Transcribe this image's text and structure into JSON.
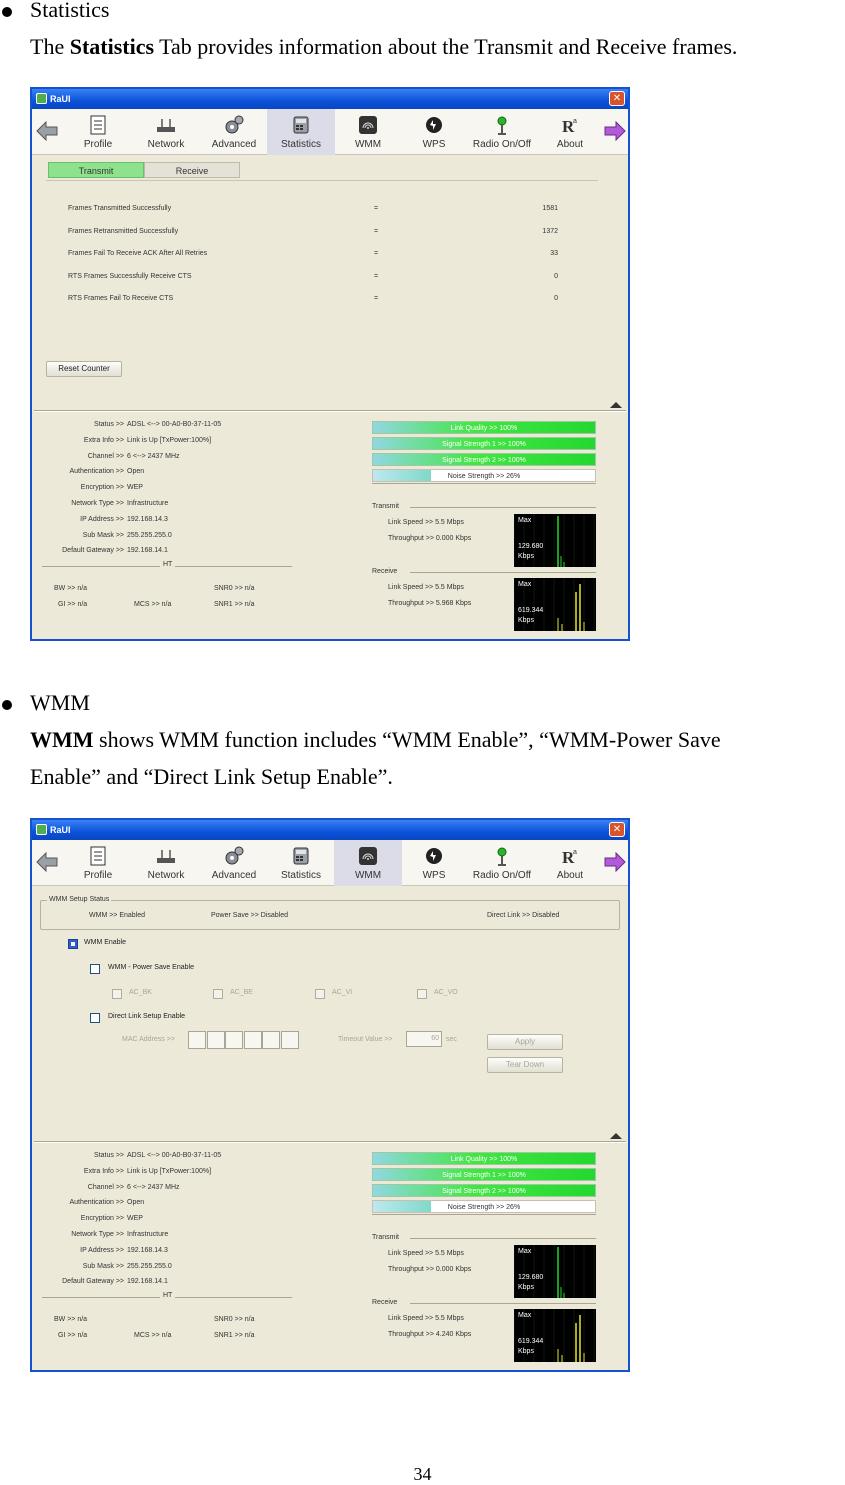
{
  "section1": {
    "heading": "Statistics",
    "intro_prefix": "The ",
    "intro_bold": "Statistics",
    "intro_suffix": " Tab provides information about the Transmit and Receive frames."
  },
  "section2": {
    "heading": "WMM",
    "intro_bold": "WMM",
    "intro_line1": " shows WMM function includes “WMM Enable”, “WMM-Power Save",
    "intro_line2": "Enable” and “Direct Link Setup Enable”."
  },
  "page_number": "34",
  "app": {
    "title": "RaUI",
    "close_glyph": "✕",
    "toolbar": [
      "Profile",
      "Network",
      "Advanced",
      "Statistics",
      "WMM",
      "WPS",
      "Radio On/Off",
      "About"
    ],
    "status": {
      "rows": [
        {
          "k": "Status >>",
          "v": "ADSL <--> 00-A0-B0-37-11-05"
        },
        {
          "k": "Extra Info >>",
          "v": "Link is Up [TxPower:100%]"
        },
        {
          "k": "Channel >>",
          "v": "6 <--> 2437 MHz"
        },
        {
          "k": "Authentication >>",
          "v": "Open"
        },
        {
          "k": "Encryption >>",
          "v": "WEP"
        },
        {
          "k": "Network Type >>",
          "v": "Infrastructure"
        },
        {
          "k": "IP Address >>",
          "v": "192.168.14.3"
        },
        {
          "k": "Sub Mask >>",
          "v": "255.255.255.0"
        },
        {
          "k": "Default Gateway >>",
          "v": "192.168.14.1"
        }
      ],
      "ht_label": "HT",
      "bw": "BW >> n/a",
      "gi": "GI >> n/a",
      "mcs": "MCS >> n/a",
      "snr0": "SNR0 >> n/a",
      "snr1": "SNR1 >> n/a"
    },
    "bars": {
      "link_quality": "Link Quality >> 100%",
      "signal1": "Signal Strength 1 >> 100%",
      "signal2": "Signal Strength 2 >> 100%",
      "noise": "Noise Strength >> 26%",
      "link_quality_level": 100,
      "signal1_level": 100,
      "signal2_level": 100,
      "noise_level": 26
    },
    "transmit": {
      "title": "Transmit",
      "link_speed": "Link Speed >>  5.5 Mbps",
      "throughput": "Throughput >>  0.000 Kbps",
      "graph_max": "Max",
      "graph_rate": "129.680",
      "graph_unit": "Kbps"
    },
    "receive": {
      "title": "Receive",
      "link_speed": "Link Speed >>  5.5 Mbps",
      "graph_max": "Max",
      "graph_rate": "619.344",
      "graph_unit": "Kbps"
    }
  },
  "stats_window": {
    "tabs": [
      "Transmit",
      "Receive"
    ],
    "rows": [
      {
        "label": "Frames Transmitted Successfully",
        "eq": "=",
        "value": "1581"
      },
      {
        "label": "Frames Retransmitted Successfully",
        "eq": "=",
        "value": "1372"
      },
      {
        "label": "Frames Fail To Receive ACK After All Retries",
        "eq": "=",
        "value": "33"
      },
      {
        "label": "RTS Frames Successfully Receive CTS",
        "eq": "=",
        "value": "0"
      },
      {
        "label": "RTS Frames Fail To Receive CTS",
        "eq": "=",
        "value": "0"
      }
    ],
    "reset_button": "Reset Counter",
    "receive_throughput": "Throughput >>  5.968 Kbps"
  },
  "wmm_window": {
    "setup_legend": "WMM Setup Status",
    "wmm_status": "WMM >> Enabled",
    "power_save_status": "Power Save >> Disabled",
    "direct_link_status": "Direct Link >> Disabled",
    "wmm_enable": "WMM Enable",
    "power_save_enable": "WMM - Power Save Enable",
    "ac": [
      "AC_BK",
      "AC_BE",
      "AC_VI",
      "AC_VO"
    ],
    "direct_link_enable": "Direct Link Setup Enable",
    "mac_label": "MAC Address >>",
    "timeout_label": "Timeout Value >>",
    "timeout_value": "60",
    "timeout_unit": "sec",
    "apply": "Apply",
    "tear_down": "Tear Down",
    "receive_throughput": "Throughput >>  4.240 Kbps"
  }
}
